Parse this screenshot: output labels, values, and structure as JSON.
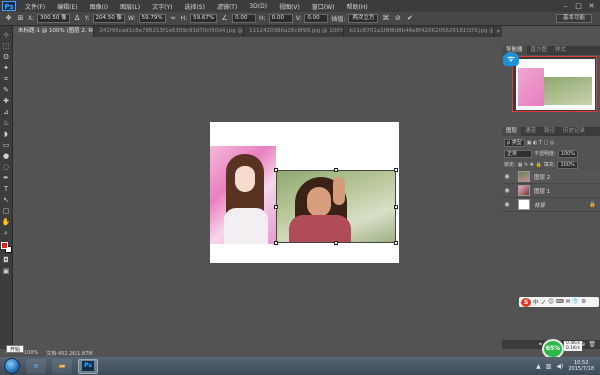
{
  "menubar": {
    "logo": "Ps",
    "items": [
      "文件(F)",
      "编辑(E)",
      "图像(I)",
      "图层(L)",
      "文字(Y)",
      "选择(S)",
      "滤镜(T)",
      "3D(D)",
      "视图(V)",
      "窗口(W)",
      "帮助(H)"
    ],
    "window_controls": [
      "–",
      "□",
      "✕"
    ]
  },
  "options": {
    "x_label": "X:",
    "x_value": "300.50 像",
    "y_label": "Y:",
    "y_value": "204.50 像",
    "w_label": "W:",
    "w_value": "59.79%",
    "h_label": "H:",
    "h_value": "59.67%",
    "angle_value": "0.00",
    "hskew_label": "H:",
    "hskew_value": "0.00",
    "vskew_label": "V:",
    "vskew_value": "0.00",
    "interp_label": "插值:",
    "interp_value": "两次立方",
    "workspace": "基本功能"
  },
  "tabs": [
    {
      "label": "未标题-1 @ 100% (图层 2, RGB/8)*",
      "active": true
    },
    {
      "label": "241f95cad1c8a786213f1e6309c93d70cf50d4.jpg @ 100%(RGB/8)",
      "active": false
    },
    {
      "label": "1112420980a26c8f99.jpg @ 100%(RGB/8)",
      "active": false
    },
    {
      "label": "b21c8701a1f8f8d8b46e8f4206205626181f2f3.jpg @ 100%(RGB/8)",
      "active": false
    }
  ],
  "tools": [
    "⊹",
    "⬚",
    "ʘ",
    "✦",
    "⌗",
    "✎",
    "✚",
    "⊿",
    "♨",
    "◗",
    "▭",
    "●",
    "◌",
    "✒",
    "T",
    "↖",
    "▢",
    "✋",
    "⌕"
  ],
  "navigator": {
    "tabs": [
      "导航器",
      "直方图",
      "样式"
    ]
  },
  "layers_panel": {
    "tabs": [
      "图层",
      "通道",
      "路径",
      "历史记录"
    ],
    "filter_label": "ρ 类型",
    "blend_mode": "正常",
    "opacity_label": "不透明度:",
    "opacity_value": "100%",
    "lock_label": "锁定:",
    "fill_label": "填充:",
    "fill_value": "100%",
    "layers": [
      {
        "name": "图层 2",
        "selected": true,
        "locked": false
      },
      {
        "name": "图层 1",
        "selected": false,
        "locked": false
      },
      {
        "name": "背景",
        "selected": false,
        "locked": true
      }
    ]
  },
  "ime": {
    "logo": "S",
    "items": [
      "中",
      "ノ",
      "☺",
      "⌨",
      "✉",
      "👕",
      "⚙"
    ]
  },
  "netmon": {
    "value": "65%",
    "sub1": "0.4K/s",
    "sub2": "0.1K/s"
  },
  "status": {
    "tooltip": "开始",
    "zoom": "100%",
    "doc_info": "文档:452.2K/1.87M"
  },
  "taskbar": {
    "clock_time": "10:52",
    "clock_date": "2015/7/18"
  },
  "colors": {
    "foreground": "#e02020",
    "background": "#ffffff"
  }
}
